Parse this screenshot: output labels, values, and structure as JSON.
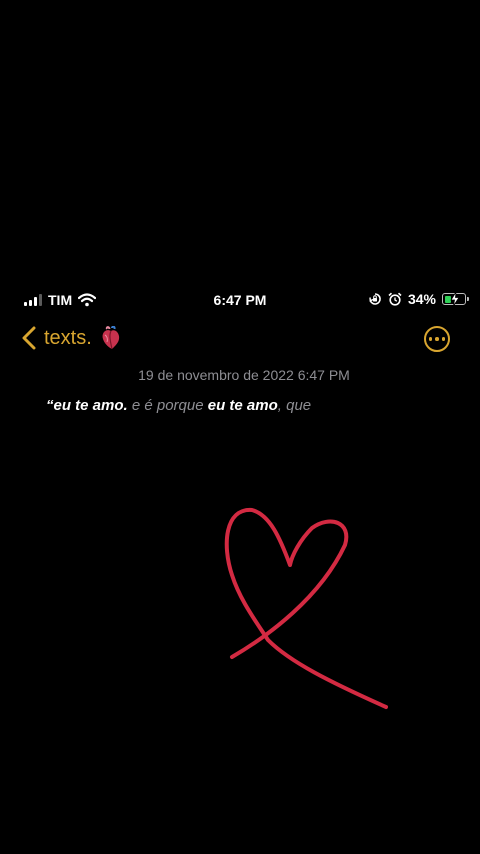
{
  "status_bar": {
    "carrier": "TIM",
    "time": "6:47 PM",
    "battery_percent": "34%",
    "battery_level": 0.34,
    "icons": [
      "signal-icon",
      "wifi-icon",
      "orientation-lock-icon",
      "alarm-icon",
      "battery-charging-icon"
    ]
  },
  "nav": {
    "back_label": "texts.",
    "back_icon": "chevron-left-icon",
    "emoji": "anatomical-heart-icon",
    "more_icon": "ellipsis-circle-icon",
    "accent_color": "#d9a630"
  },
  "note": {
    "date": "19 de novembro de 2022 6:47 PM",
    "segments": [
      {
        "text": "“eu te amo.",
        "style": "strong"
      },
      {
        "text": " e é porque ",
        "style": "dim"
      },
      {
        "text": "eu te amo",
        "style": "strong"
      },
      {
        "text": ", que",
        "style": "dim"
      }
    ]
  },
  "drawing": {
    "name": "heart-drawing",
    "color": "#d32a42"
  }
}
